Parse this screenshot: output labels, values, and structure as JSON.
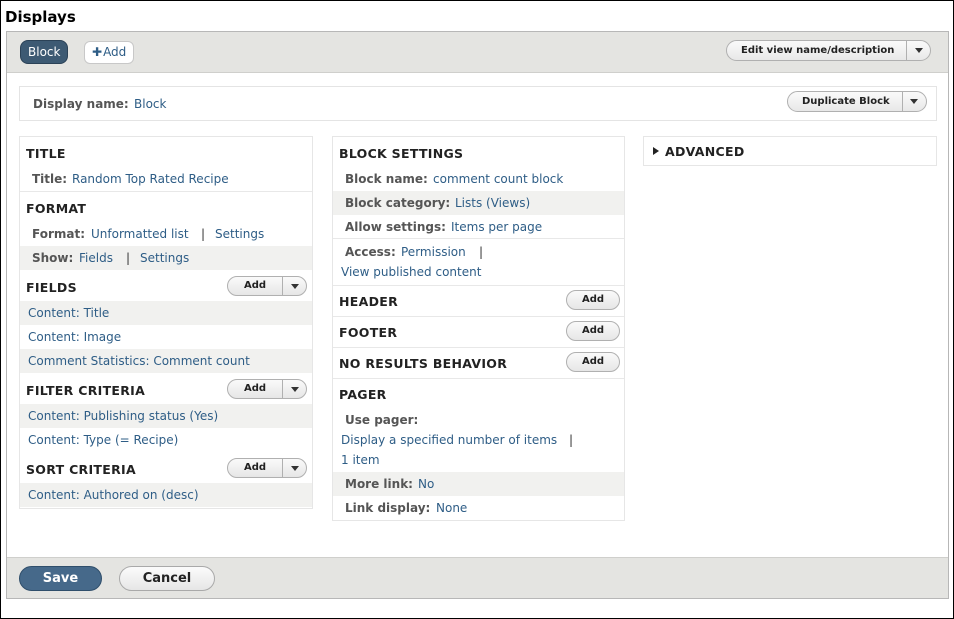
{
  "page": {
    "heading": "Displays"
  },
  "tabs": {
    "block_label": "Block",
    "add_label": "Add",
    "add_plus": "✚"
  },
  "top_actions": {
    "edit_label": "Edit view name/description"
  },
  "display_name": {
    "label": "Display name:",
    "value": "Block",
    "duplicate_label": "Duplicate Block"
  },
  "col1": {
    "title": {
      "heading": "TITLE",
      "label": "Title:",
      "value": "Random Top Rated Recipe"
    },
    "format": {
      "heading": "FORMAT",
      "format_label": "Format:",
      "format_value": "Unformatted list",
      "sep": "|",
      "format_settings": "Settings",
      "show_label": "Show:",
      "show_value": "Fields",
      "show_settings": "Settings"
    },
    "fields": {
      "heading": "FIELDS",
      "add": "Add",
      "items": [
        "Content: Title",
        "Content: Image",
        "Comment Statistics: Comment count"
      ]
    },
    "filter": {
      "heading": "FILTER CRITERIA",
      "add": "Add",
      "items": [
        "Content: Publishing status (Yes)",
        "Content: Type (= Recipe)"
      ]
    },
    "sort": {
      "heading": "SORT CRITERIA",
      "add": "Add",
      "items": [
        "Content: Authored on (desc)"
      ]
    }
  },
  "col2": {
    "block_settings": {
      "heading": "BLOCK SETTINGS",
      "name_label": "Block name:",
      "name_value": "comment count block",
      "category_label": "Block category:",
      "category_value": "Lists (Views)",
      "allow_label": "Allow settings:",
      "allow_value": "Items per page",
      "access_label": "Access:",
      "access_value": "Permission",
      "access_sep": "|",
      "access_detail": "View published content"
    },
    "header": {
      "heading": "HEADER",
      "add": "Add"
    },
    "footer": {
      "heading": "FOOTER",
      "add": "Add"
    },
    "no_results": {
      "heading": "NO RESULTS BEHAVIOR",
      "add": "Add"
    },
    "pager": {
      "heading": "PAGER",
      "use_label": "Use pager:",
      "use_value": "Display a specified number of items",
      "use_sep": "|",
      "use_value2": "1 item",
      "more_label": "More link:",
      "more_value": "No",
      "link_label": "Link display:",
      "link_value": "None"
    }
  },
  "col3": {
    "advanced_label": "ADVANCED"
  },
  "footer_actions": {
    "save_label": "Save",
    "cancel_label": "Cancel"
  }
}
